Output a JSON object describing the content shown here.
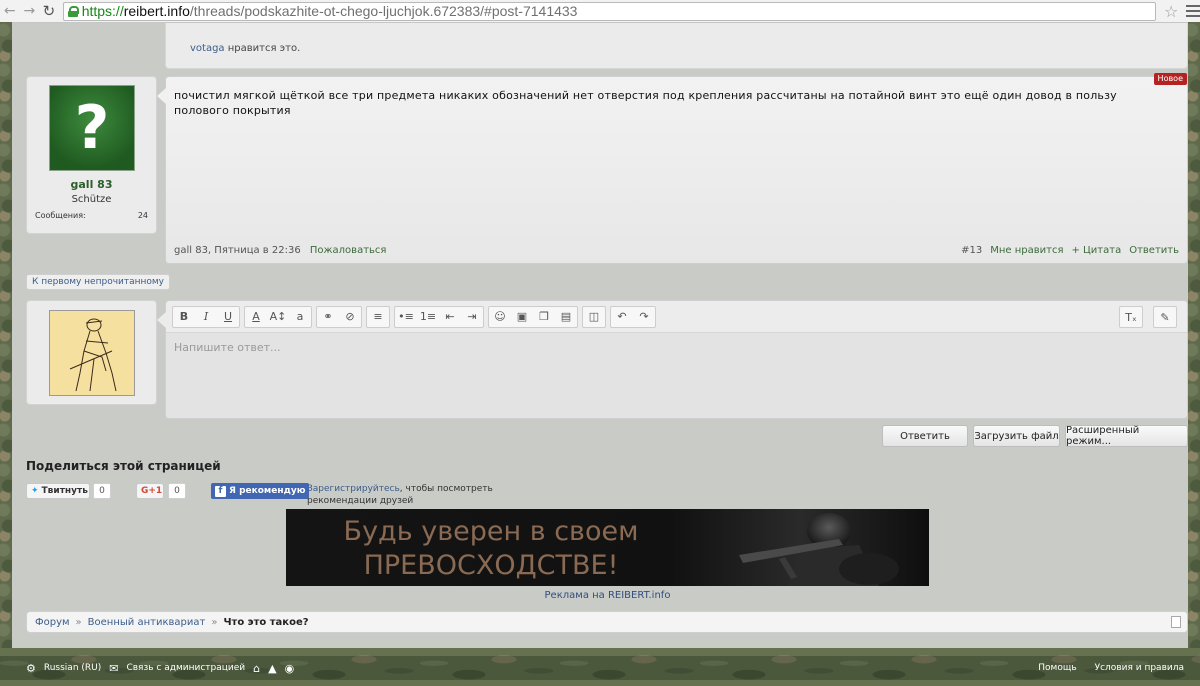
{
  "browser": {
    "url_https": "https://",
    "url_host": "reibert.info",
    "url_path": "/threads/podskazhite-ot-chego-ljuchjok.672383/#post-7141433"
  },
  "prev_post": {
    "liker": "votaga",
    "likes_text": "нравится это."
  },
  "post": {
    "username": "gall 83",
    "usertitle": "Schütze",
    "messages_label": "Сообщения:",
    "messages_count": "24",
    "badge": "Новое",
    "text": "почистил мягкой щёткой все три предмета никаких обозначений нет отверстия под крепления рассчитаны на потайной винт это ещё один довод в пользу полового покрытия",
    "meta": "gall 83, Пятница в 22:36",
    "report": "Пожаловаться",
    "number": "#13",
    "like": "Мне нравится",
    "quote": "+ Цитата",
    "reply": "Ответить"
  },
  "first_unread": "К первому непрочитанному",
  "editor": {
    "placeholder": "Напишите ответ..."
  },
  "buttons": {
    "reply": "Ответить",
    "upload": "Загрузить файл",
    "advanced": "Расширенный режим..."
  },
  "share": {
    "title": "Поделиться этой страницей",
    "tweet": "Твитнуть",
    "tweet_count": "0",
    "gplus": "G+1",
    "gplus_count": "0",
    "fb_recommend": "Я рекомендую",
    "fb_register": "Зарегистрируйтесь",
    "fb_text": ", чтобы посмотреть рекомендации друзей"
  },
  "banner": {
    "line1": "Будь уверен в своем",
    "line2": "ПРЕВОСХОДСТВЕ!",
    "ad_label": "Реклама на REIBERT.info"
  },
  "breadcrumb": {
    "items": [
      "Форум",
      "Военный антиквариат"
    ],
    "current": "Что это такое?"
  },
  "footer": {
    "language": "Russian (RU)",
    "contact": "Связь с администрацией",
    "help": "Помощь",
    "terms": "Условия и правила"
  }
}
